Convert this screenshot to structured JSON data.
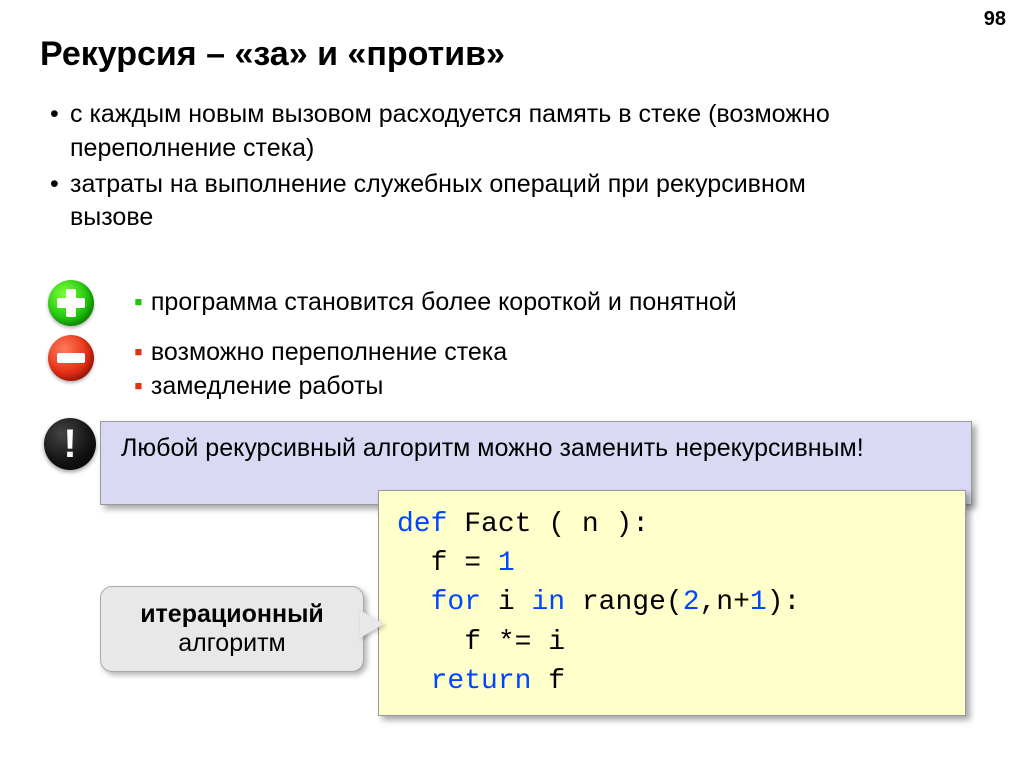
{
  "pageNumber": "98",
  "title": "Рекурсия – «за» и «против»",
  "bullets": [
    "с каждым новым вызовом расходуется память в стеке (возможно переполнение стека)",
    "затраты на выполнение служебных операций при рекурсивном вызове"
  ],
  "pro": "программа становится более короткой и понятной",
  "cons": {
    "c1": "возможно переполнение стека",
    "c2": "замедление работы"
  },
  "note": "Любой рекурсивный алгоритм можно заменить нерекурсивным!",
  "exclaim": "!",
  "label": {
    "l1": "итерационный",
    "l2": "алгоритм"
  },
  "code": {
    "k_def": "def",
    "fn": " Fact ( n ):",
    "l2a": "  f = ",
    "l2b": "1",
    "l3a": "  ",
    "k_for": "for",
    "l3b": " i ",
    "k_in": "in",
    "l3c": " range(",
    "l3d": "2",
    "l3e": ",n+",
    "l3f": "1",
    "l3g": "):",
    "l4": "    f *= i",
    "l5a": "  ",
    "k_return": "return",
    "l5b": " f"
  }
}
